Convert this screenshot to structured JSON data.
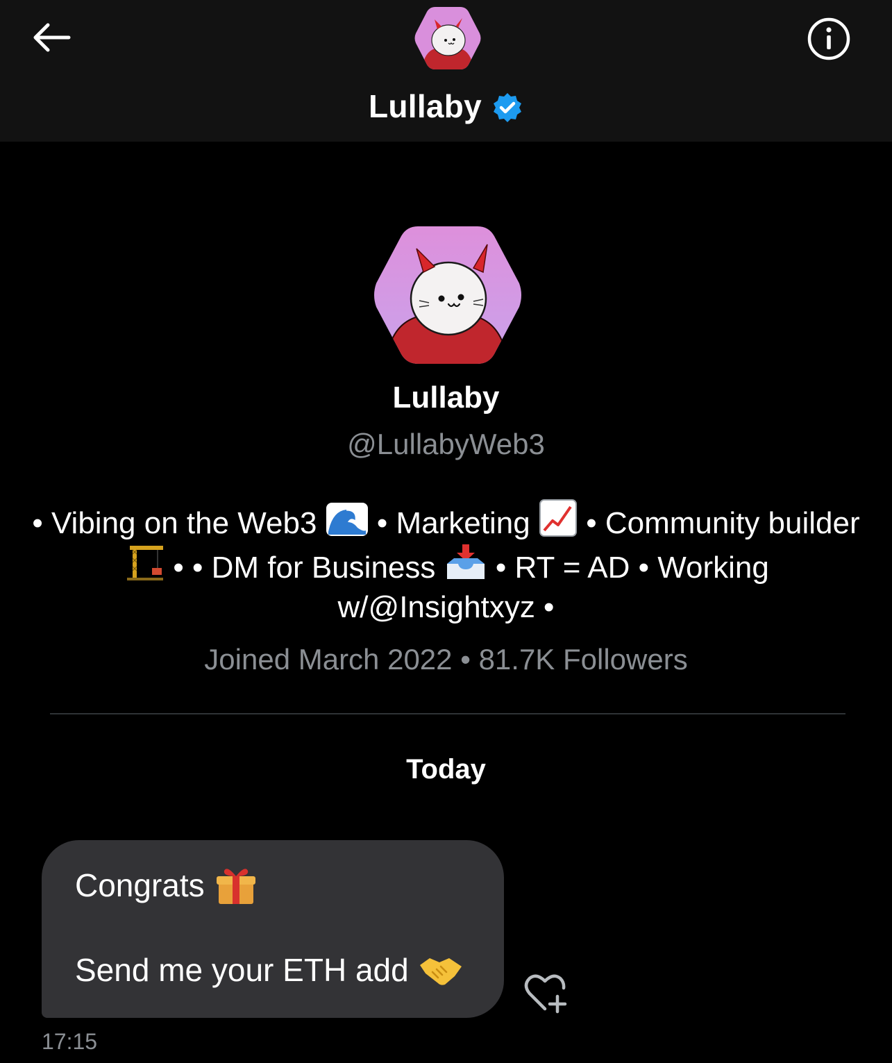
{
  "header": {
    "name": "Lullaby",
    "back_icon": "arrow-left-icon",
    "info_icon": "info-circle-icon",
    "verified_icon": "verified-badge-icon",
    "background": "#121212"
  },
  "profile": {
    "name": "Lullaby",
    "handle": "@LullabyWeb3",
    "avatar_colors": {
      "background": "#d98fdc",
      "hoodie": "#c0262d",
      "face": "#f3f1f1",
      "horns": "#d8262b"
    },
    "bio": {
      "seg1": "• Vibing on the Web3",
      "seg2": "• Marketing",
      "seg3": "• Community builder",
      "seg4": "• • DM for Business",
      "seg5": "• RT = AD • Working w/@Insightxyz •",
      "emoji": [
        "wave-icon",
        "chart-increasing-icon",
        "crane-icon",
        "inbox-tray-icon"
      ]
    },
    "meta": "Joined March 2022 • 81.7K Followers"
  },
  "conversation": {
    "date_separator": "Today",
    "messages": [
      {
        "line1": "Congrats",
        "line1_emoji": "gift-icon",
        "line2": "Send me your ETH add",
        "line2_emoji": "handshake-icon",
        "time": "17:15",
        "bubble_color": "#333336"
      }
    ],
    "react_icon": "heart-plus-icon"
  },
  "colors": {
    "verified": "#1d9bf0",
    "muted_text": "#8b8f94",
    "text": "#ffffff"
  }
}
